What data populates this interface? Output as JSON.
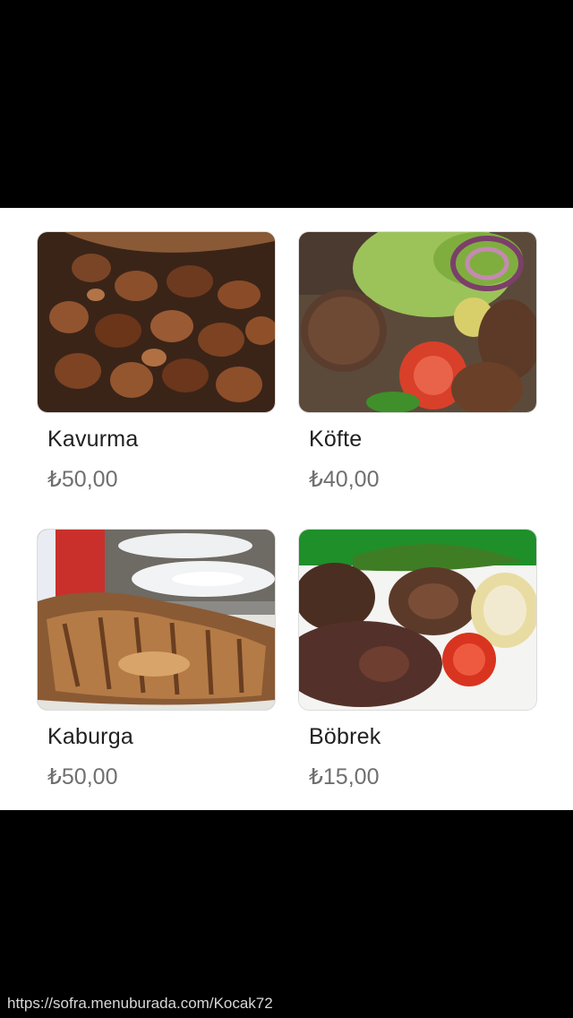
{
  "menu": {
    "items": [
      {
        "name": "Kavurma",
        "price": "₺50,00",
        "image_icon": "kavurma-photo"
      },
      {
        "name": "Köfte",
        "price": "₺40,00",
        "image_icon": "kofte-photo"
      },
      {
        "name": "Kaburga",
        "price": "₺50,00",
        "image_icon": "kaburga-photo"
      },
      {
        "name": "Böbrek",
        "price": "₺15,00",
        "image_icon": "bobrek-photo"
      }
    ]
  },
  "footer": {
    "url": "https://sofra.menuburada.com/Kocak72"
  },
  "colors": {
    "panel_background": "#ffffff",
    "frame_background": "#000000",
    "name_text": "#212121",
    "price_text": "#6f6f6f"
  }
}
